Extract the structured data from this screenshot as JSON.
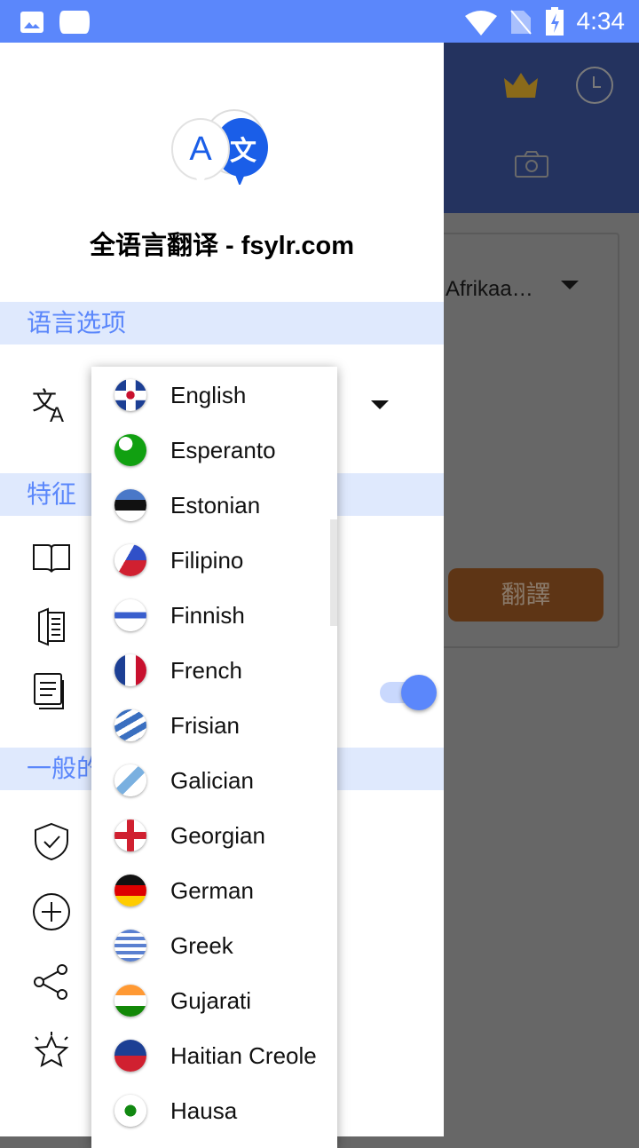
{
  "status_bar": {
    "time": "4:34",
    "icons": [
      "image-icon",
      "app-notification-icon",
      "wifi-icon",
      "no-sim-icon",
      "battery-charging-icon"
    ]
  },
  "background": {
    "source_language": "Afrikaa…",
    "translate_button": "翻譯",
    "icons": [
      "crown-icon",
      "history-icon",
      "camera-icon"
    ],
    "colors": {
      "header": "#24335f",
      "button": "#5e3515"
    }
  },
  "drawer": {
    "title": "全语言翻译 - fsylr.com",
    "sections": {
      "language": "语言选项",
      "features": "特征",
      "general": "一般的"
    },
    "toggle_on": true,
    "accent": "#5b87fb"
  },
  "language_dropdown": {
    "items": [
      {
        "label": "English",
        "flag": "gb"
      },
      {
        "label": "Esperanto",
        "flag": "eo"
      },
      {
        "label": "Estonian",
        "flag": "ee"
      },
      {
        "label": "Filipino",
        "flag": "ph"
      },
      {
        "label": "Finnish",
        "flag": "fi"
      },
      {
        "label": "French",
        "flag": "fr"
      },
      {
        "label": "Frisian",
        "flag": "fy"
      },
      {
        "label": "Galician",
        "flag": "gl"
      },
      {
        "label": "Georgian",
        "flag": "ge"
      },
      {
        "label": "German",
        "flag": "de"
      },
      {
        "label": "Greek",
        "flag": "gr"
      },
      {
        "label": "Gujarati",
        "flag": "in"
      },
      {
        "label": "Haitian Creole",
        "flag": "ht"
      },
      {
        "label": "Hausa",
        "flag": "ng"
      }
    ]
  }
}
